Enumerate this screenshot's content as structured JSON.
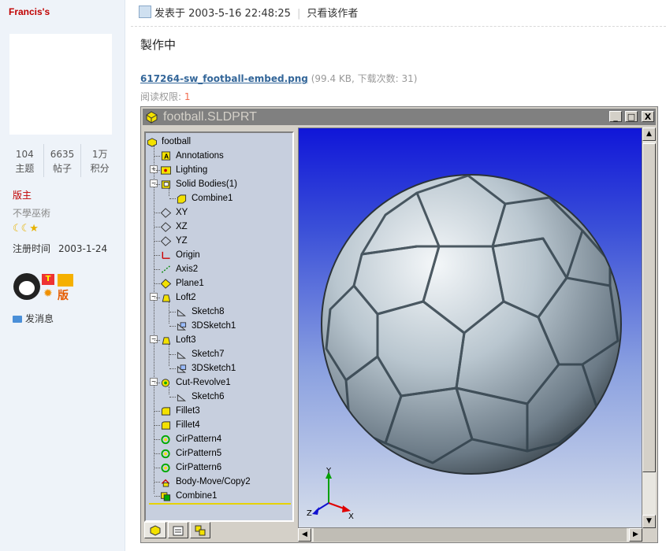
{
  "user": {
    "name": "Francis's",
    "stats": [
      {
        "value": "104",
        "label": "主题"
      },
      {
        "value": "6635",
        "label": "帖子"
      },
      {
        "value": "1万",
        "label": "积分"
      }
    ],
    "role": "版主",
    "motto": "不學巫術",
    "rank_icons": "☾☾★",
    "register_label": "注册时间",
    "register_date": "2003-1-24",
    "badge_text": "版",
    "message_label": "发消息"
  },
  "post": {
    "posted_label": "发表于 2003-5-16 22:48:25",
    "only_author": "只看该作者",
    "content": "製作中",
    "attachment": {
      "name": "617264-sw_football-embed.png",
      "meta": "(99.4 KB, 下载次数: 31)"
    },
    "permission_label": "阅读权限: ",
    "permission_value": "1"
  },
  "window": {
    "title": "football.SLDPRT",
    "buttons": [
      "_",
      "□",
      "X"
    ]
  },
  "feature_tree": [
    {
      "label": "football",
      "icon": "part-icon"
    },
    {
      "label": "Annotations",
      "icon": "annotations-icon"
    },
    {
      "label": "Lighting",
      "icon": "lighting-icon"
    },
    {
      "label": "Solid Bodies(1)",
      "icon": "solid-bodies-icon"
    },
    {
      "label": "Combine1",
      "icon": "body-icon"
    },
    {
      "label": "XY",
      "icon": "plane-icon"
    },
    {
      "label": "XZ",
      "icon": "plane-icon"
    },
    {
      "label": "YZ",
      "icon": "plane-icon"
    },
    {
      "label": "Origin",
      "icon": "origin-icon"
    },
    {
      "label": "Axis2",
      "icon": "axis-icon"
    },
    {
      "label": "Plane1",
      "icon": "plane1-icon"
    },
    {
      "label": "Loft2",
      "icon": "loft-icon"
    },
    {
      "label": "Sketch8",
      "icon": "sketch-icon"
    },
    {
      "label": "3DSketch1",
      "icon": "3dsketch-icon"
    },
    {
      "label": "Loft3",
      "icon": "loft-icon"
    },
    {
      "label": "Sketch7",
      "icon": "sketch-icon"
    },
    {
      "label": "3DSketch1",
      "icon": "3dsketch-icon"
    },
    {
      "label": "Cut-Revolve1",
      "icon": "cut-revolve-icon"
    },
    {
      "label": "Sketch6",
      "icon": "sketch-icon"
    },
    {
      "label": "Fillet3",
      "icon": "fillet-icon"
    },
    {
      "label": "Fillet4",
      "icon": "fillet-icon"
    },
    {
      "label": "CirPattern4",
      "icon": "circular-pattern-icon"
    },
    {
      "label": "CirPattern5",
      "icon": "circular-pattern-icon"
    },
    {
      "label": "CirPattern6",
      "icon": "circular-pattern-icon"
    },
    {
      "label": "Body-Move/Copy2",
      "icon": "body-move-icon"
    },
    {
      "label": "Combine1",
      "icon": "combine-icon"
    }
  ],
  "triad": {
    "x": "X",
    "y": "Y",
    "z": "Z"
  },
  "colors": {
    "accent_red": "#c00000",
    "link_blue": "#336699",
    "viewport_top": "#1016d8",
    "viewport_bottom": "#d6deeb"
  }
}
